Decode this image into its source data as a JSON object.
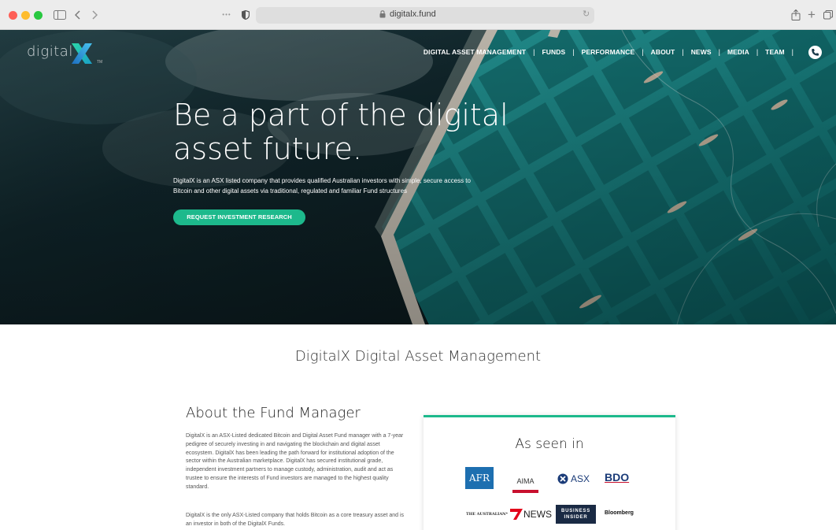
{
  "browser": {
    "url": "digitalx.fund"
  },
  "site": {
    "logo_text": "digital",
    "logo_tm": "TM"
  },
  "nav": {
    "items": [
      "DIGITAL ASSET MANAGEMENT",
      "FUNDS",
      "PERFORMANCE",
      "ABOUT",
      "NEWS",
      "MEDIA",
      "TEAM"
    ],
    "separator": "|"
  },
  "hero": {
    "title": "Be a part of the digital asset future.",
    "description": "DigitalX is an ASX listed company that provides qualified Australian investors with simple, secure access to Bitcoin and other digital assets via traditional, regulated and familiar Fund structures",
    "cta_label": "REQUEST INVESTMENT RESEARCH"
  },
  "section": {
    "title": "DigitalX Digital Asset Management"
  },
  "about": {
    "title": "About the Fund Manager",
    "paragraph1": "DigitalX is an ASX-Listed dedicated Bitcoin and Digital Asset Fund manager with a 7-year pedigree of securely investing in and navigating the blockchain and digital asset ecosystem. DigitalX has been leading the path forward for institutional adoption of the sector within the Australian marketplace. DigitalX has secured institutional grade, independent investment partners to manage custody, administration, audit and act as trustee to ensure the interests of Fund investors are managed to the highest quality standard.",
    "paragraph2": "DigitalX is the only ASX-Listed company that holds Bitcoin as a core treasury asset and is an investor in both of the DigitalX Funds."
  },
  "press": {
    "title": "As seen in",
    "logos": {
      "afr": "AFR",
      "aima": "AIMA",
      "asx": "ASX",
      "bdo": "BDO",
      "australian": "THE AUSTRALIAN*",
      "news": "NEWS",
      "bi_line1": "BUSINESS",
      "bi_line2": "INSIDER",
      "bloomberg": "Bloomberg"
    }
  },
  "colors": {
    "accent": "#1db98c",
    "afr_blue": "#1d6fb0",
    "navy": "#1a3b78"
  }
}
